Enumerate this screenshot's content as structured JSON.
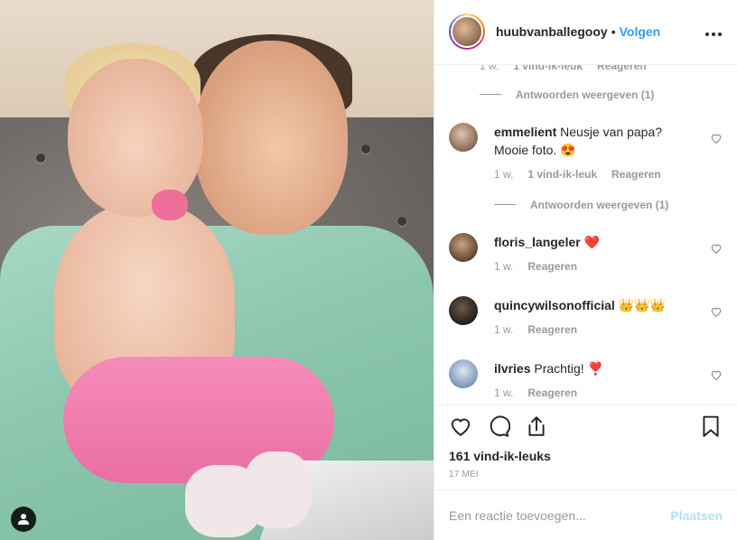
{
  "header": {
    "username": "huubvanballegooy",
    "separator": "•",
    "follow_label": "Volgen",
    "more_label": "•••"
  },
  "comments": {
    "partial_meta": {
      "time": "1 w.",
      "likes": "1 vind-ik-leuk",
      "reply": "Reageren"
    },
    "replies_label_1": "Antwoorden weergeven (1)",
    "items": [
      {
        "user": "emmelient",
        "text": "Neusje van papa? Mooie foto. 😍",
        "time": "1 w.",
        "likes": "1 vind-ik-leuk",
        "reply": "Reageren",
        "replies_label": "Antwoorden weergeven (1)"
      },
      {
        "user": "floris_langeler",
        "text": "❤️",
        "time": "1 w.",
        "reply": "Reageren"
      },
      {
        "user": "quincywilsonofficial",
        "text": "👑👑👑",
        "time": "1 w.",
        "reply": "Reageren"
      },
      {
        "user": "ilvries",
        "text": "Prachtig! ❣️",
        "time": "1 w.",
        "reply": "Reageren"
      }
    ]
  },
  "actions": {
    "icons": [
      "heart-icon",
      "comment-icon",
      "share-icon",
      "bookmark-icon"
    ]
  },
  "likes_label": "161 vind-ik-leuks",
  "date_label": "17 MEI",
  "add_comment": {
    "placeholder": "Een reactie toevoegen...",
    "post_label": "Plaatsen"
  },
  "colors": {
    "accent": "#3897f0",
    "post_disabled": "#b2dffc",
    "muted": "#999999",
    "text": "#262626"
  }
}
